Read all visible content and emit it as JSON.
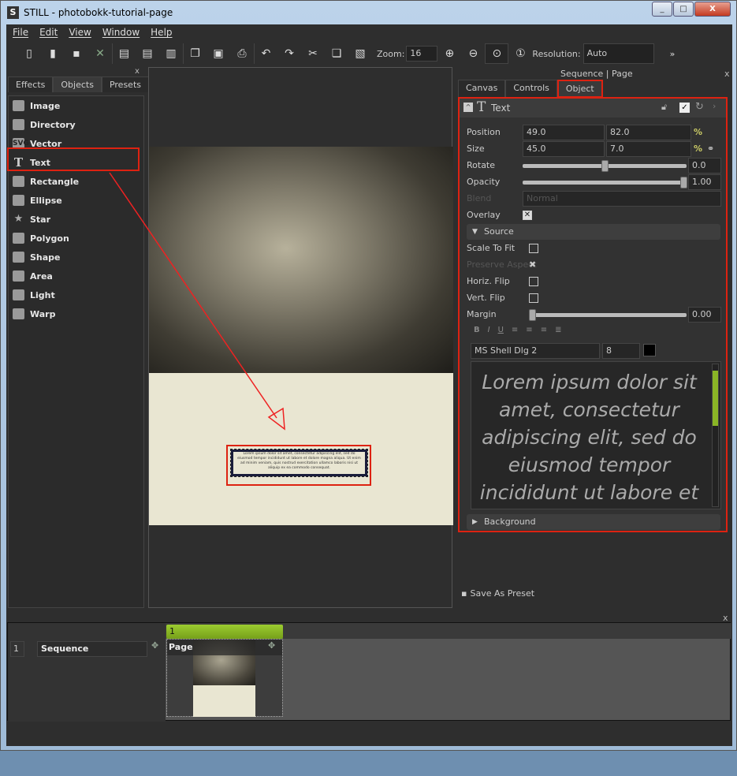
{
  "window": {
    "title": "STILL - photobokk-tutorial-page",
    "logo": "S",
    "min": "_",
    "max": "□",
    "close": "X"
  },
  "menu": [
    "File",
    "Edit",
    "View",
    "Window",
    "Help"
  ],
  "toolbar": {
    "icons": [
      "new-icon",
      "open-icon",
      "save-icon",
      "close-icon",
      "import-icon",
      "export-icon",
      "export-all-icon",
      "copy-pages-icon",
      "render-icon",
      "print-icon",
      "undo-icon",
      "redo-icon",
      "cut-icon",
      "copy-icon",
      "paste-icon"
    ],
    "zoom_label": "Zoom:",
    "zoom_value": "16",
    "resolution_label": "Resolution:",
    "resolution_value": "Auto",
    "more": "»"
  },
  "left_panel": {
    "close": "x",
    "tabs": [
      "Effects",
      "Objects",
      "Presets"
    ],
    "active_tab": "Objects",
    "items": [
      {
        "label": "Image",
        "icon": "image-icon"
      },
      {
        "label": "Directory",
        "icon": "directory-icon"
      },
      {
        "label": "Vector",
        "icon": "vector-icon",
        "glyph": "SVG"
      },
      {
        "label": "Text",
        "icon": "text-icon",
        "glyph": "T"
      },
      {
        "label": "Rectangle",
        "icon": "rectangle-icon"
      },
      {
        "label": "Ellipse",
        "icon": "ellipse-icon"
      },
      {
        "label": "Star",
        "icon": "star-icon",
        "glyph": "★"
      },
      {
        "label": "Polygon",
        "icon": "polygon-icon"
      },
      {
        "label": "Shape",
        "icon": "shape-icon"
      },
      {
        "label": "Area",
        "icon": "area-icon"
      },
      {
        "label": "Light",
        "icon": "light-icon"
      },
      {
        "label": "Warp",
        "icon": "warp-icon"
      }
    ]
  },
  "canvas": {
    "text_object": "Lorem ipsum dolor sit amet, consectetur adipiscing elit, sed do eiusmod tempor incididunt ut labore et dolore magna aliqua. Ut enim ad minim veniam, quis nostrud exercitation ullamco laboris nisi ut aliquip ex ea commodo consequat."
  },
  "right_panel": {
    "header": "Sequence | Page",
    "close": "x",
    "tabs": [
      "Canvas",
      "Controls",
      "Object"
    ],
    "active_tab": "Object",
    "object": {
      "title": "Text",
      "position_label": "Position",
      "position_x": "49.0",
      "position_y": "82.0",
      "size_label": "Size",
      "size_w": "45.0",
      "size_h": "7.0",
      "percent": "%",
      "rotate_label": "Rotate",
      "rotate_value": "0.0",
      "rotate_fraction": 0.5,
      "opacity_label": "Opacity",
      "opacity_value": "1.00",
      "opacity_fraction": 1.0,
      "blend_label": "Blend",
      "blend_value": "Normal",
      "overlay_label": "Overlay",
      "overlay_checked": true,
      "source_label": "Source",
      "scale_to_fit_label": "Scale To Fit",
      "preserve_aspect_label": "Preserve Aspect",
      "horiz_flip_label": "Horiz. Flip",
      "vert_flip_label": "Vert. Flip",
      "margin_label": "Margin",
      "margin_value": "0.00",
      "margin_fraction": 0.0,
      "format_buttons": [
        "B",
        "I",
        "U"
      ],
      "font": "MS Shell Dlg 2",
      "font_size": "8",
      "text_color": "#000000",
      "text": "Lorem ipsum dolor sit amet, consectetur adipiscing elit, sed do eiusmod tempor incididunt ut labore et dolore magna aliqua",
      "background_label": "Background"
    },
    "save_preset": "Save As Preset"
  },
  "timeline": {
    "close": "x",
    "row_number": "1",
    "sequence_label": "Sequence",
    "page_number": "1",
    "page_label": "Page"
  },
  "accent": "#8ab526",
  "highlight": "#dd1111"
}
